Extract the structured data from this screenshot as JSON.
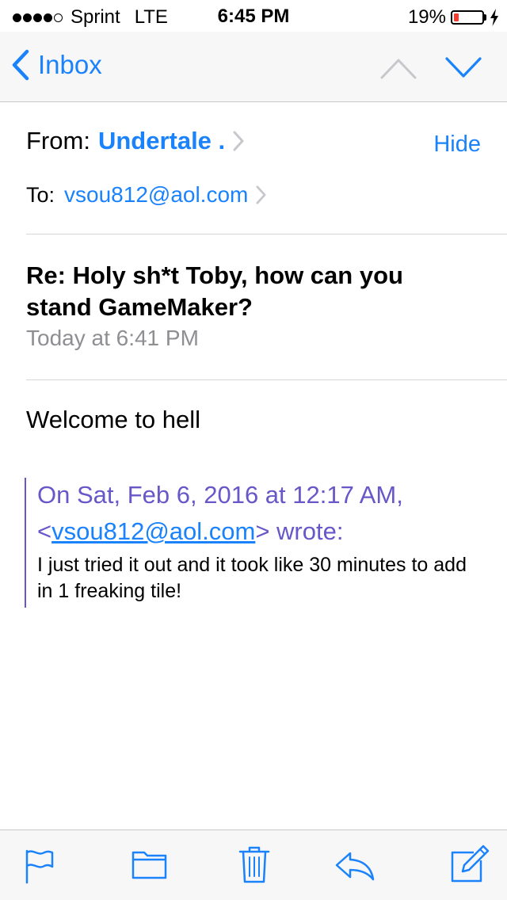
{
  "status": {
    "carrier": "Sprint",
    "network": "LTE",
    "time": "6:45 PM",
    "battery": "19%",
    "battery_level": 0.19,
    "battery_color": "#ff3b30"
  },
  "nav": {
    "back_label": "Inbox"
  },
  "header": {
    "from_label": "From:",
    "from_name": "Undertale .",
    "hide_label": "Hide",
    "to_label": "To:",
    "to_address": "vsou812@aol.com",
    "subject": "Re: Holy sh*t Toby, how can you stand GameMaker?",
    "date": "Today at 6:41 PM"
  },
  "message": {
    "body": "Welcome to hell",
    "quote_line1": "On Sat, Feb 6, 2016 at 12:17 AM,",
    "quote_open": "<",
    "quote_email": "vsou812@aol.com",
    "quote_close": "> wrote:",
    "quote_text": "I just tried it out and it took like 30 minutes to add in 1 freaking tile!"
  },
  "colors": {
    "accent": "#1a82fb",
    "quote": "#6757c8"
  },
  "toolbar": {
    "icons": [
      "flag-icon",
      "folder-icon",
      "trash-icon",
      "reply-icon",
      "compose-icon"
    ]
  }
}
